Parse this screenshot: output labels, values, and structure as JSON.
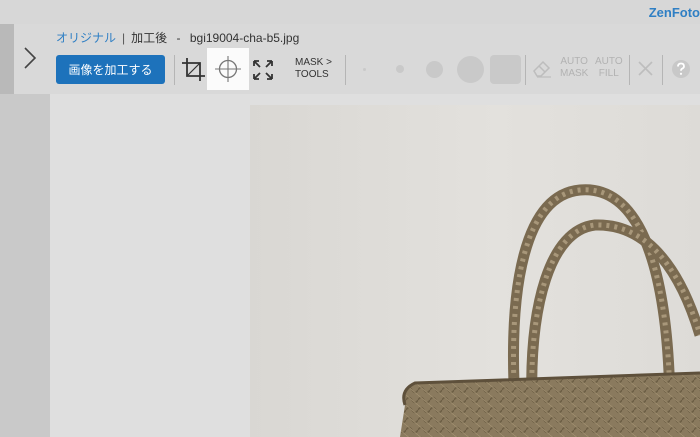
{
  "app": {
    "brand": "ZenFoto"
  },
  "breadcrumb": {
    "original": "オリジナル",
    "separator": "|",
    "processed_prefix": "加工後",
    "dash": "-",
    "filename": "bgi19004-cha-b5.jpg"
  },
  "toolbar": {
    "process_label": "画像を加工する",
    "mask_tools_line1": "MASK",
    "mask_tools_line2": "TOOLS",
    "mask_tools_chevron": ">",
    "auto_mask_line1": "AUTO",
    "auto_mask_line2": "MASK",
    "auto_fill_line1": "AUTO",
    "auto_fill_line2": "FILL",
    "icons": [
      "chevron-right-icon",
      "crop-icon",
      "crosshair-icon",
      "expand-arrows-icon",
      "brush-size-xs-icon",
      "brush-size-s-icon",
      "brush-size-m-icon",
      "brush-size-l-icon",
      "brush-size-xl-icon",
      "eraser-icon",
      "close-icon",
      "help-icon"
    ]
  },
  "colors": {
    "accent": "#1d72bb",
    "link": "#2f7fc4",
    "toolbar_bg": "#d9d9d9",
    "canvas_bg": "#dfdfdf"
  }
}
